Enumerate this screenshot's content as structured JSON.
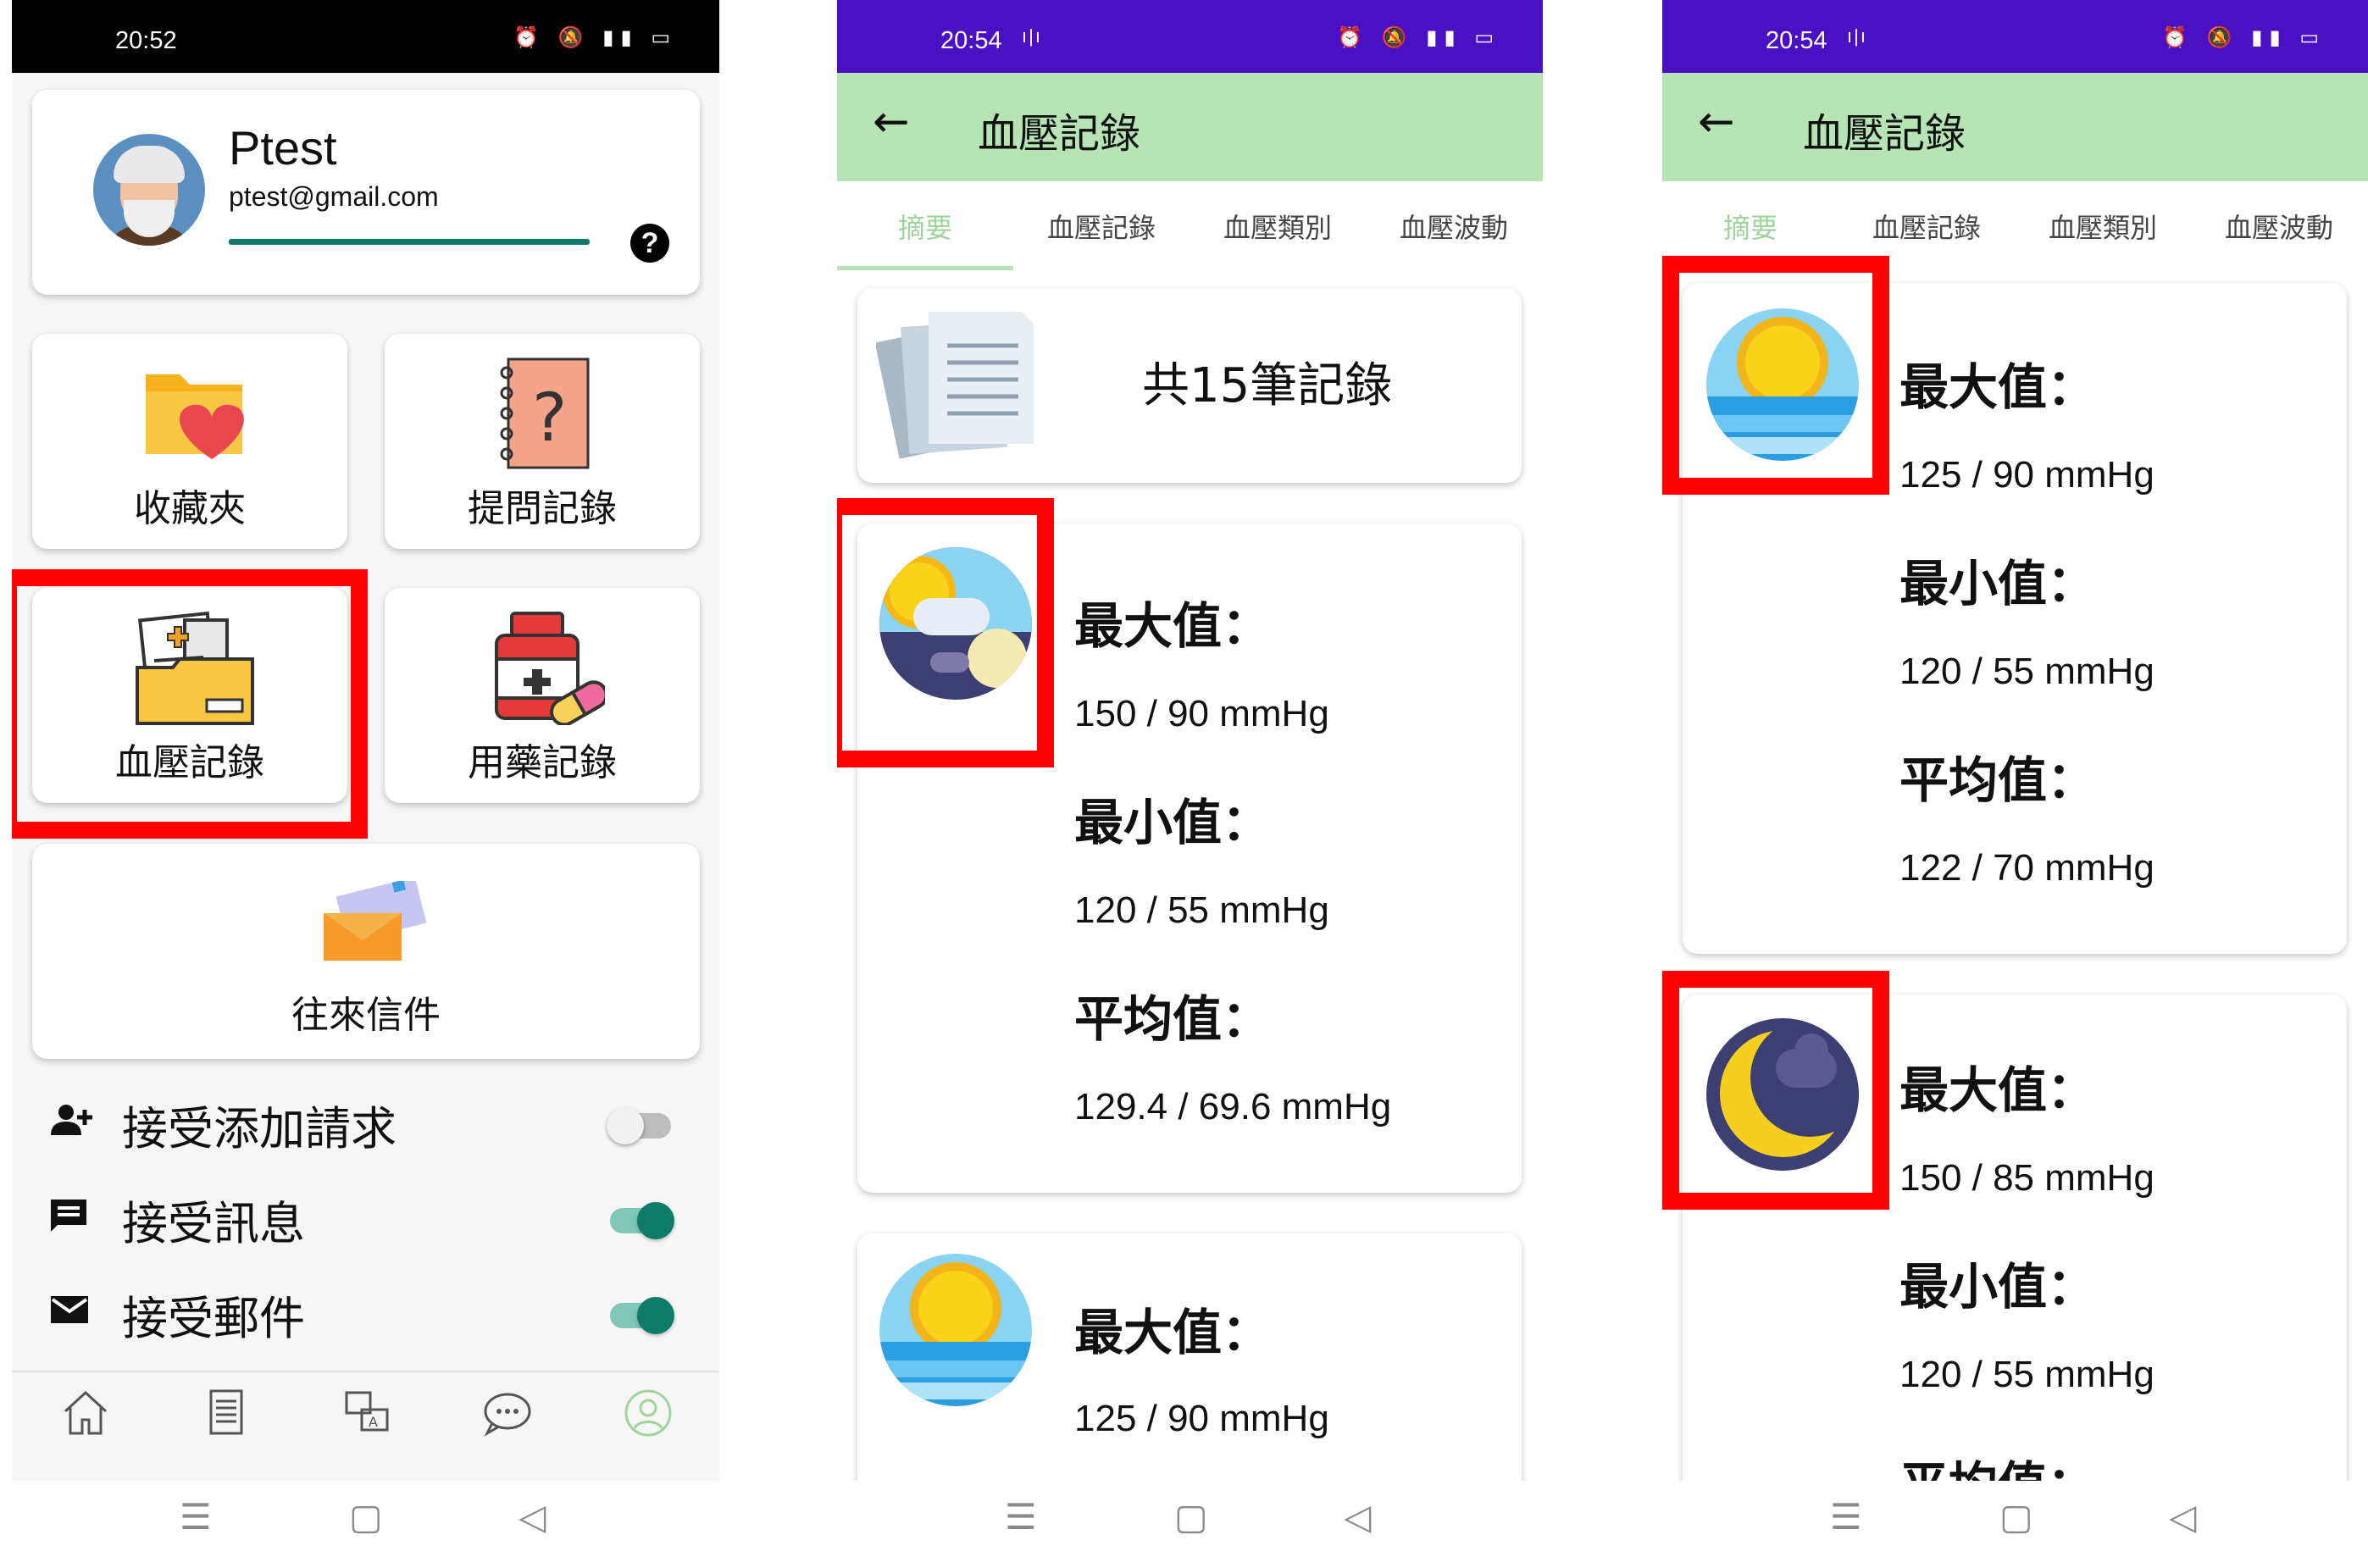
{
  "screen1": {
    "status_time": "20:52",
    "profile": {
      "name": "Ptest",
      "email": "ptest@gmail.com",
      "help_label": "?"
    },
    "tiles": {
      "favorites": "收藏夾",
      "question_records": "提問記錄",
      "blood_pressure_records": "血壓記錄",
      "medication_records": "用藥記錄",
      "mail": "往來信件"
    },
    "settings": [
      {
        "label": "接受添加請求",
        "enabled": false
      },
      {
        "label": "接受訊息",
        "enabled": true
      },
      {
        "label": "接受郵件",
        "enabled": true
      }
    ],
    "bottom_nav": [
      "home-icon",
      "document-icon",
      "translate-icon",
      "chat-icon",
      "profile-icon"
    ]
  },
  "screen2": {
    "status_time": "20:54",
    "appbar": {
      "back": "←",
      "title": "血壓記錄"
    },
    "tabs": [
      "摘要",
      "血壓記錄",
      "血壓類別",
      "血壓波動"
    ],
    "total_records": "共15筆記錄",
    "summary_all": {
      "max_label": "最大值：",
      "max_value": "150 / 90 mmHg",
      "min_label": "最小值：",
      "min_value": "120 / 55 mmHg",
      "avg_label": "平均值：",
      "avg_value": "129.4 / 69.6 mmHg"
    },
    "summary_day_partial": {
      "max_label": "最大值：",
      "max_value": "125 / 90 mmHg"
    }
  },
  "screen3": {
    "status_time": "20:54",
    "appbar": {
      "back": "←",
      "title": "血壓記錄"
    },
    "tabs": [
      "摘要",
      "血壓記錄",
      "血壓類別",
      "血壓波動"
    ],
    "summary_day": {
      "max_label": "最大值：",
      "max_value": "125 / 90 mmHg",
      "min_label": "最小值：",
      "min_value": "120 / 55 mmHg",
      "avg_label": "平均值：",
      "avg_value": "122 / 70 mmHg"
    },
    "summary_night": {
      "max_label": "最大值：",
      "max_value": "150 / 85 mmHg",
      "min_label": "最小值：",
      "min_value": "120 / 55 mmHg",
      "avg_label_partial": "平均值："
    }
  },
  "colors": {
    "status_purple": "#4a10c4",
    "appbar_green": "#b7e4b5",
    "toggle_on": "#0e7b69",
    "highlight_red": "#ff0000",
    "progress_teal": "#127a6a"
  }
}
